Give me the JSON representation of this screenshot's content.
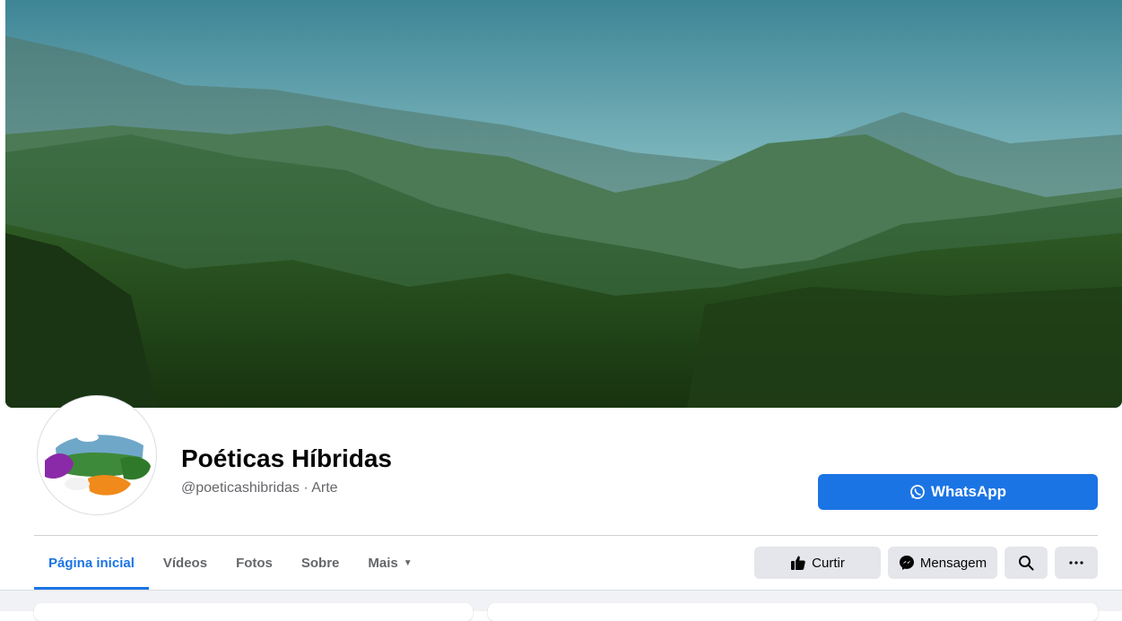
{
  "page": {
    "name": "Poéticas Híbridas",
    "handle": "@poeticashibridas",
    "separator": "·",
    "category": "Arte"
  },
  "cta": {
    "label": "WhatsApp",
    "icon": "whatsapp-icon"
  },
  "tabs": [
    {
      "label": "Página inicial",
      "active": true
    },
    {
      "label": "Vídeos"
    },
    {
      "label": "Fotos"
    },
    {
      "label": "Sobre"
    },
    {
      "label": "Mais",
      "icon": "caret-down-icon"
    }
  ],
  "actions": {
    "like": {
      "label": "Curtir",
      "icon": "thumbs-up-icon"
    },
    "message": {
      "label": "Mensagem",
      "icon": "messenger-icon"
    },
    "search": {
      "icon": "search-icon"
    },
    "more": {
      "icon": "more-icon"
    }
  },
  "colors": {
    "accent": "#1b74e4",
    "button_gray": "#e4e6eb",
    "text_primary": "#050505",
    "text_secondary": "#65676b",
    "page_bg": "#f0f2f5"
  }
}
